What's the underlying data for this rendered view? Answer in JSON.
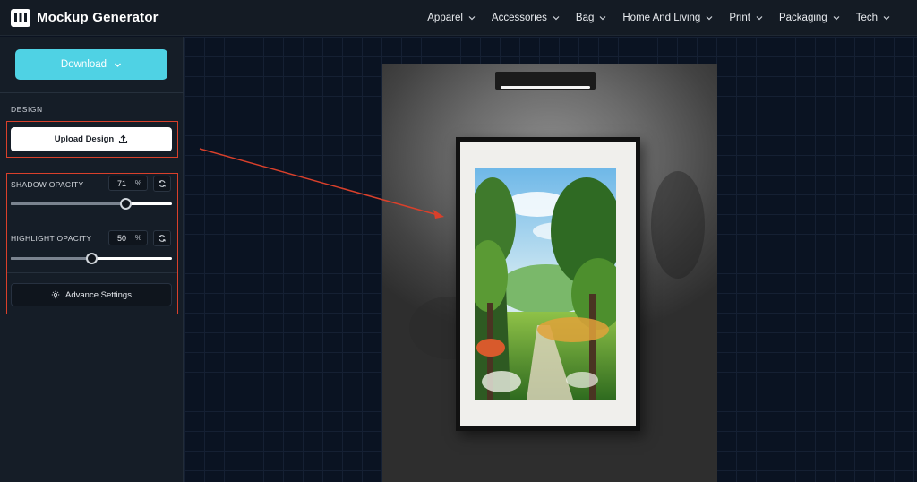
{
  "app": {
    "title": "Mockup Generator"
  },
  "nav": {
    "items": [
      {
        "label": "Apparel"
      },
      {
        "label": "Accessories"
      },
      {
        "label": "Bag"
      },
      {
        "label": "Home And Living"
      },
      {
        "label": "Print"
      },
      {
        "label": "Packaging"
      },
      {
        "label": "Tech"
      }
    ]
  },
  "sidebar": {
    "download_label": "Download",
    "design_section_label": "DESIGN",
    "upload_label": "Upload Design",
    "shadow": {
      "label": "SHADOW OPACITY",
      "value": "71",
      "unit": "%",
      "percent": 71
    },
    "highlight": {
      "label": "HIGHLIGHT OPACITY",
      "value": "50",
      "unit": "%",
      "percent": 50
    },
    "advance_label": "Advance Settings"
  },
  "colors": {
    "accent": "#4fd2e4",
    "annotation": "#d9402b",
    "topbar": "#141b24",
    "sidebar": "#151d27",
    "canvas": "#0a1322"
  },
  "icons": {
    "logo": "logo-icon",
    "download_chevron": "chevron-down-icon",
    "upload": "upload-icon",
    "reset": "refresh-icon",
    "advance": "gear-icon"
  }
}
